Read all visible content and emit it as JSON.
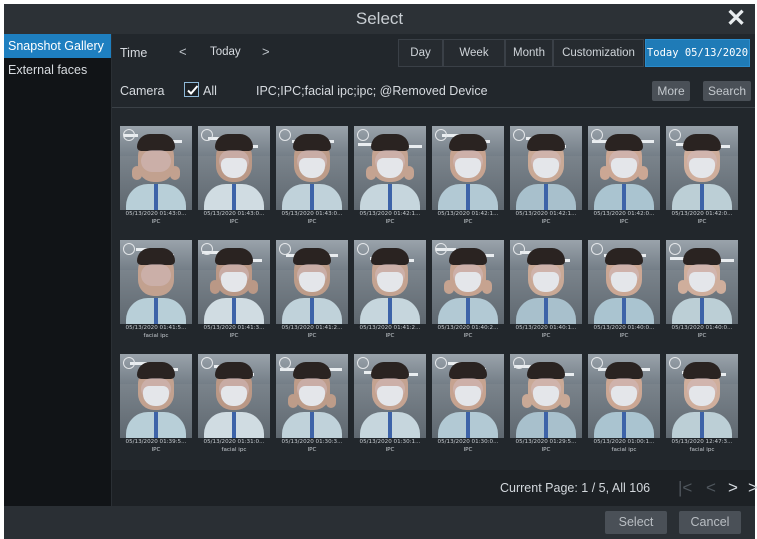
{
  "window": {
    "title": "Select"
  },
  "sidebar": {
    "items": [
      {
        "label": "Snapshot Gallery",
        "active": true
      },
      {
        "label": "External faces",
        "active": false
      }
    ]
  },
  "time": {
    "label": "Time",
    "value": "Today",
    "prev_icon": "chevron-left-icon",
    "next_icon": "chevron-right-icon"
  },
  "range_tabs": [
    {
      "label": "Day",
      "active": false
    },
    {
      "label": "Week",
      "active": false
    },
    {
      "label": "Month",
      "active": false
    },
    {
      "label": "Customization",
      "active": false
    },
    {
      "label": "Today 05/13/2020",
      "active": true
    }
  ],
  "camera": {
    "label": "Camera",
    "all_label": "All",
    "all_checked": true,
    "list": "IPC;IPC;facial ipc;ipc;  @Removed Device"
  },
  "buttons": {
    "more": "More",
    "search": "Search",
    "select": "Select",
    "cancel": "Cancel"
  },
  "snapshots": [
    {
      "time": "05/13/2020 01:43:0...",
      "source": "IPC"
    },
    {
      "time": "05/13/2020 01:43:0...",
      "source": "IPC"
    },
    {
      "time": "05/13/2020 01:43:0...",
      "source": "IPC"
    },
    {
      "time": "05/13/2020 01:42:1...",
      "source": "IPC"
    },
    {
      "time": "05/13/2020 01:42:1...",
      "source": "IPC"
    },
    {
      "time": "05/13/2020 01:42:1...",
      "source": "IPC"
    },
    {
      "time": "05/13/2020 01:42:0...",
      "source": "IPC"
    },
    {
      "time": "05/13/2020 01:42:0...",
      "source": "IPC"
    },
    {
      "time": "05/13/2020 01:41:5...",
      "source": "facial ipc"
    },
    {
      "time": "05/13/2020 01:41:3...",
      "source": "IPC"
    },
    {
      "time": "05/13/2020 01:41:2...",
      "source": "IPC"
    },
    {
      "time": "05/13/2020 01:41:2...",
      "source": "IPC"
    },
    {
      "time": "05/13/2020 01:40:2...",
      "source": "IPC"
    },
    {
      "time": "05/13/2020 01:40:1...",
      "source": "IPC"
    },
    {
      "time": "05/13/2020 01:40:0...",
      "source": "IPC"
    },
    {
      "time": "05/13/2020 01:40:0...",
      "source": "IPC"
    },
    {
      "time": "05/13/2020 01:39:5...",
      "source": "IPC"
    },
    {
      "time": "05/13/2020 01:31:0...",
      "source": "facial ipc"
    },
    {
      "time": "05/13/2020 01:30:3...",
      "source": "IPC"
    },
    {
      "time": "05/13/2020 01:30:1...",
      "source": "IPC"
    },
    {
      "time": "05/13/2020 01:30:0...",
      "source": "IPC"
    },
    {
      "time": "05/13/2020 01:29:5...",
      "source": "IPC"
    },
    {
      "time": "05/13/2020 01:00:1...",
      "source": "facial ipc"
    },
    {
      "time": "05/13/2020 12:47:3...",
      "source": "facial ipc"
    }
  ],
  "pager": {
    "text": "Current Page: 1 / 5, All 106",
    "first_icon": "first-page-icon",
    "prev_icon": "prev-page-icon",
    "next_icon": "next-page-icon",
    "last_icon": "last-page-icon"
  },
  "icons": {
    "close": "close-icon",
    "checkbox": "checkbox-checked-icon",
    "select_circle": "select-circle-icon"
  }
}
